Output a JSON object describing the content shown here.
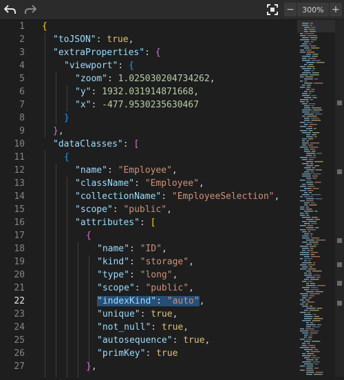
{
  "toolbar": {
    "undo_icon": "undo-arrow-icon",
    "redo_icon": "redo-arrow-icon",
    "fit_icon": "fit-to-screen-icon",
    "zoom_out_label": "−",
    "zoom_level": "300%",
    "zoom_in_label": "+"
  },
  "editor": {
    "active_line": 22,
    "line_numbers": [
      "1",
      "2",
      "3",
      "4",
      "5",
      "6",
      "7",
      "8",
      "9",
      "10",
      "11",
      "12",
      "13",
      "14",
      "15",
      "16",
      "17",
      "18",
      "19",
      "20",
      "21",
      "22",
      "23",
      "24",
      "25",
      "26",
      "27"
    ],
    "lines": [
      [
        [
          "br1",
          "{"
        ]
      ],
      [
        [
          "k",
          "\"toJSON\""
        ],
        [
          "p",
          ": "
        ],
        [
          "b",
          "true"
        ],
        [
          "p",
          ","
        ]
      ],
      [
        [
          "k",
          "\"extraProperties\""
        ],
        [
          "p",
          ": "
        ],
        [
          "br2",
          "{"
        ]
      ],
      [
        [
          "k",
          "\"viewport\""
        ],
        [
          "p",
          ": "
        ],
        [
          "br3",
          "{"
        ]
      ],
      [
        [
          "k",
          "\"zoom\""
        ],
        [
          "p",
          ": "
        ],
        [
          "n",
          "1.025030204734262"
        ],
        [
          "p",
          ","
        ]
      ],
      [
        [
          "k",
          "\"y\""
        ],
        [
          "p",
          ": "
        ],
        [
          "n",
          "1932.031914871668"
        ],
        [
          "p",
          ","
        ]
      ],
      [
        [
          "k",
          "\"x\""
        ],
        [
          "p",
          ": "
        ],
        [
          "n",
          "-477.9530235630467"
        ]
      ],
      [
        [
          "br3",
          "}"
        ]
      ],
      [
        [
          "br2",
          "}"
        ],
        [
          "p",
          ","
        ]
      ],
      [
        [
          "k",
          "\"dataClasses\""
        ],
        [
          "p",
          ": "
        ],
        [
          "br2",
          "["
        ]
      ],
      [
        [
          "br3",
          "{"
        ]
      ],
      [
        [
          "k",
          "\"name\""
        ],
        [
          "p",
          ": "
        ],
        [
          "s",
          "\"Employee\""
        ],
        [
          "p",
          ","
        ]
      ],
      [
        [
          "k",
          "\"className\""
        ],
        [
          "p",
          ": "
        ],
        [
          "s",
          "\"Employee\""
        ],
        [
          "p",
          ","
        ]
      ],
      [
        [
          "k",
          "\"collectionName\""
        ],
        [
          "p",
          ": "
        ],
        [
          "s",
          "\"EmployeeSelection\""
        ],
        [
          "p",
          ","
        ]
      ],
      [
        [
          "k",
          "\"scope\""
        ],
        [
          "p",
          ": "
        ],
        [
          "s",
          "\"public\""
        ],
        [
          "p",
          ","
        ]
      ],
      [
        [
          "k",
          "\"attributes\""
        ],
        [
          "p",
          ": "
        ],
        [
          "br1",
          "["
        ]
      ],
      [
        [
          "br2",
          "{"
        ]
      ],
      [
        [
          "k",
          "\"name\""
        ],
        [
          "p",
          ": "
        ],
        [
          "s",
          "\"ID\""
        ],
        [
          "p",
          ","
        ]
      ],
      [
        [
          "k",
          "\"kind\""
        ],
        [
          "p",
          ": "
        ],
        [
          "s",
          "\"storage\""
        ],
        [
          "p",
          ","
        ]
      ],
      [
        [
          "k",
          "\"type\""
        ],
        [
          "p",
          ": "
        ],
        [
          "s",
          "\"long\""
        ],
        [
          "p",
          ","
        ]
      ],
      [
        [
          "k",
          "\"scope\""
        ],
        [
          "p",
          ": "
        ],
        [
          "s",
          "\"public\""
        ],
        [
          "p",
          ","
        ]
      ],
      [
        [
          "k",
          "\"indexKind\""
        ],
        [
          "p",
          ": "
        ],
        [
          "s",
          "\"auto\""
        ],
        [
          "p",
          ","
        ]
      ],
      [
        [
          "k",
          "\"unique\""
        ],
        [
          "p",
          ": "
        ],
        [
          "b",
          "true"
        ],
        [
          "p",
          ","
        ]
      ],
      [
        [
          "k",
          "\"not_null\""
        ],
        [
          "p",
          ": "
        ],
        [
          "b",
          "true"
        ],
        [
          "p",
          ","
        ]
      ],
      [
        [
          "k",
          "\"autosequence\""
        ],
        [
          "p",
          ": "
        ],
        [
          "b",
          "true"
        ],
        [
          "p",
          ","
        ]
      ],
      [
        [
          "k",
          "\"primKey\""
        ],
        [
          "p",
          ": "
        ],
        [
          "b",
          "true"
        ]
      ],
      [
        [
          "br2",
          "}"
        ],
        [
          "p",
          ","
        ]
      ]
    ]
  },
  "minimap": {
    "label": "minimap"
  },
  "scrollbar": {
    "label": "vertical-scrollbar"
  }
}
